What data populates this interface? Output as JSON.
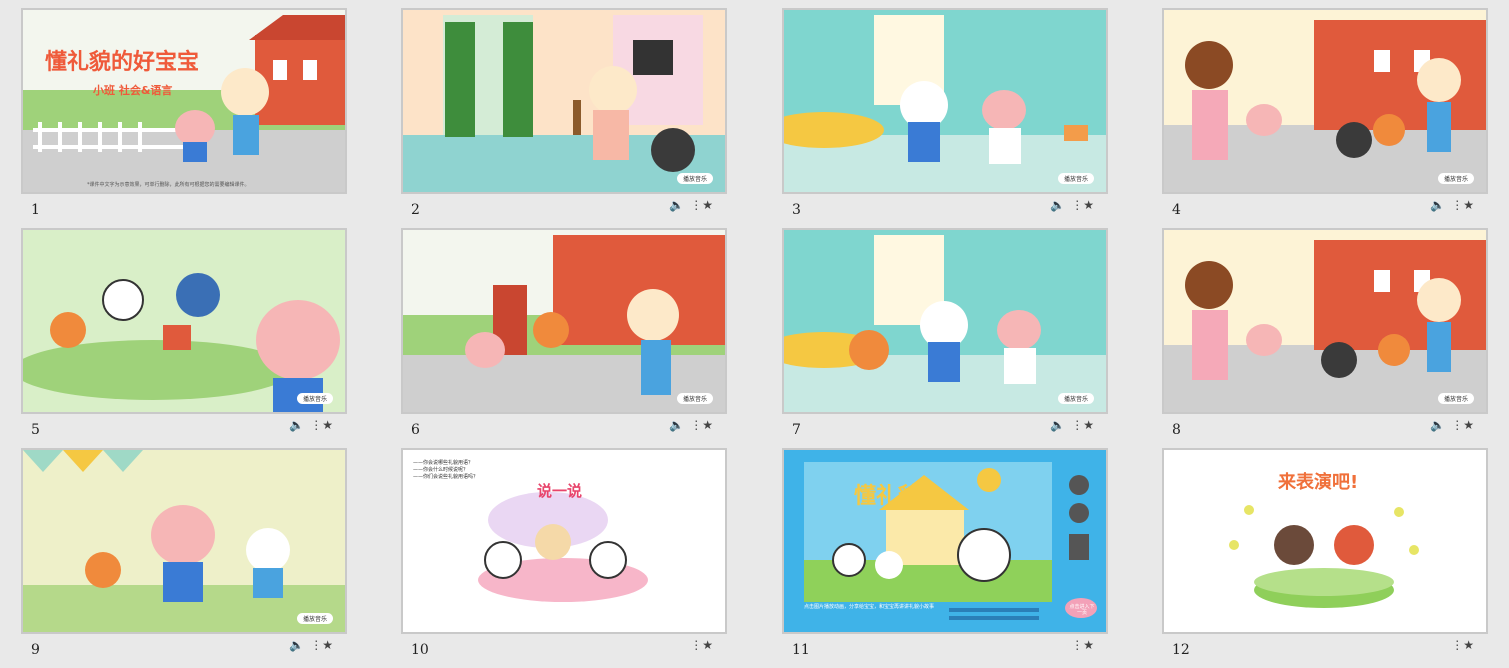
{
  "slides": [
    {
      "num": "1",
      "title": "懂礼貌的好宝宝",
      "subtitle": "小班  社会&语言",
      "footer": "*课件中文字为示意效果，可单行删除，此所有可根据您的需要编辑课件。",
      "has_audio": false
    },
    {
      "num": "2",
      "button": "播放音乐",
      "has_audio": true
    },
    {
      "num": "3",
      "button": "播放音乐",
      "has_audio": true
    },
    {
      "num": "4",
      "button": "播放音乐",
      "has_audio": true
    },
    {
      "num": "5",
      "button": "播放音乐",
      "has_audio": true
    },
    {
      "num": "6",
      "button": "播放音乐",
      "has_audio": true
    },
    {
      "num": "7",
      "button": "播放音乐",
      "has_audio": true
    },
    {
      "num": "8",
      "button": "播放音乐",
      "has_audio": true
    },
    {
      "num": "9",
      "button": "播放音乐",
      "has_audio": true
    },
    {
      "num": "10",
      "heading": "说一说",
      "questions": [
        "——你会说哪些礼貌用语？",
        "——你会什么时候说呢？",
        "——你们会说些礼貌用语吗？"
      ],
      "has_audio": false
    },
    {
      "num": "11",
      "heading": "懂礼貌",
      "caption": "点击图片播放动画，分享给宝宝，和宝宝再讲讲礼貌小故事",
      "next": "点击进入下一页",
      "has_audio": false
    },
    {
      "num": "12",
      "heading": "来表演吧!",
      "has_audio": false
    }
  ],
  "icons": {
    "audio": "speaker-icon",
    "transition": "star-transition-icon"
  }
}
